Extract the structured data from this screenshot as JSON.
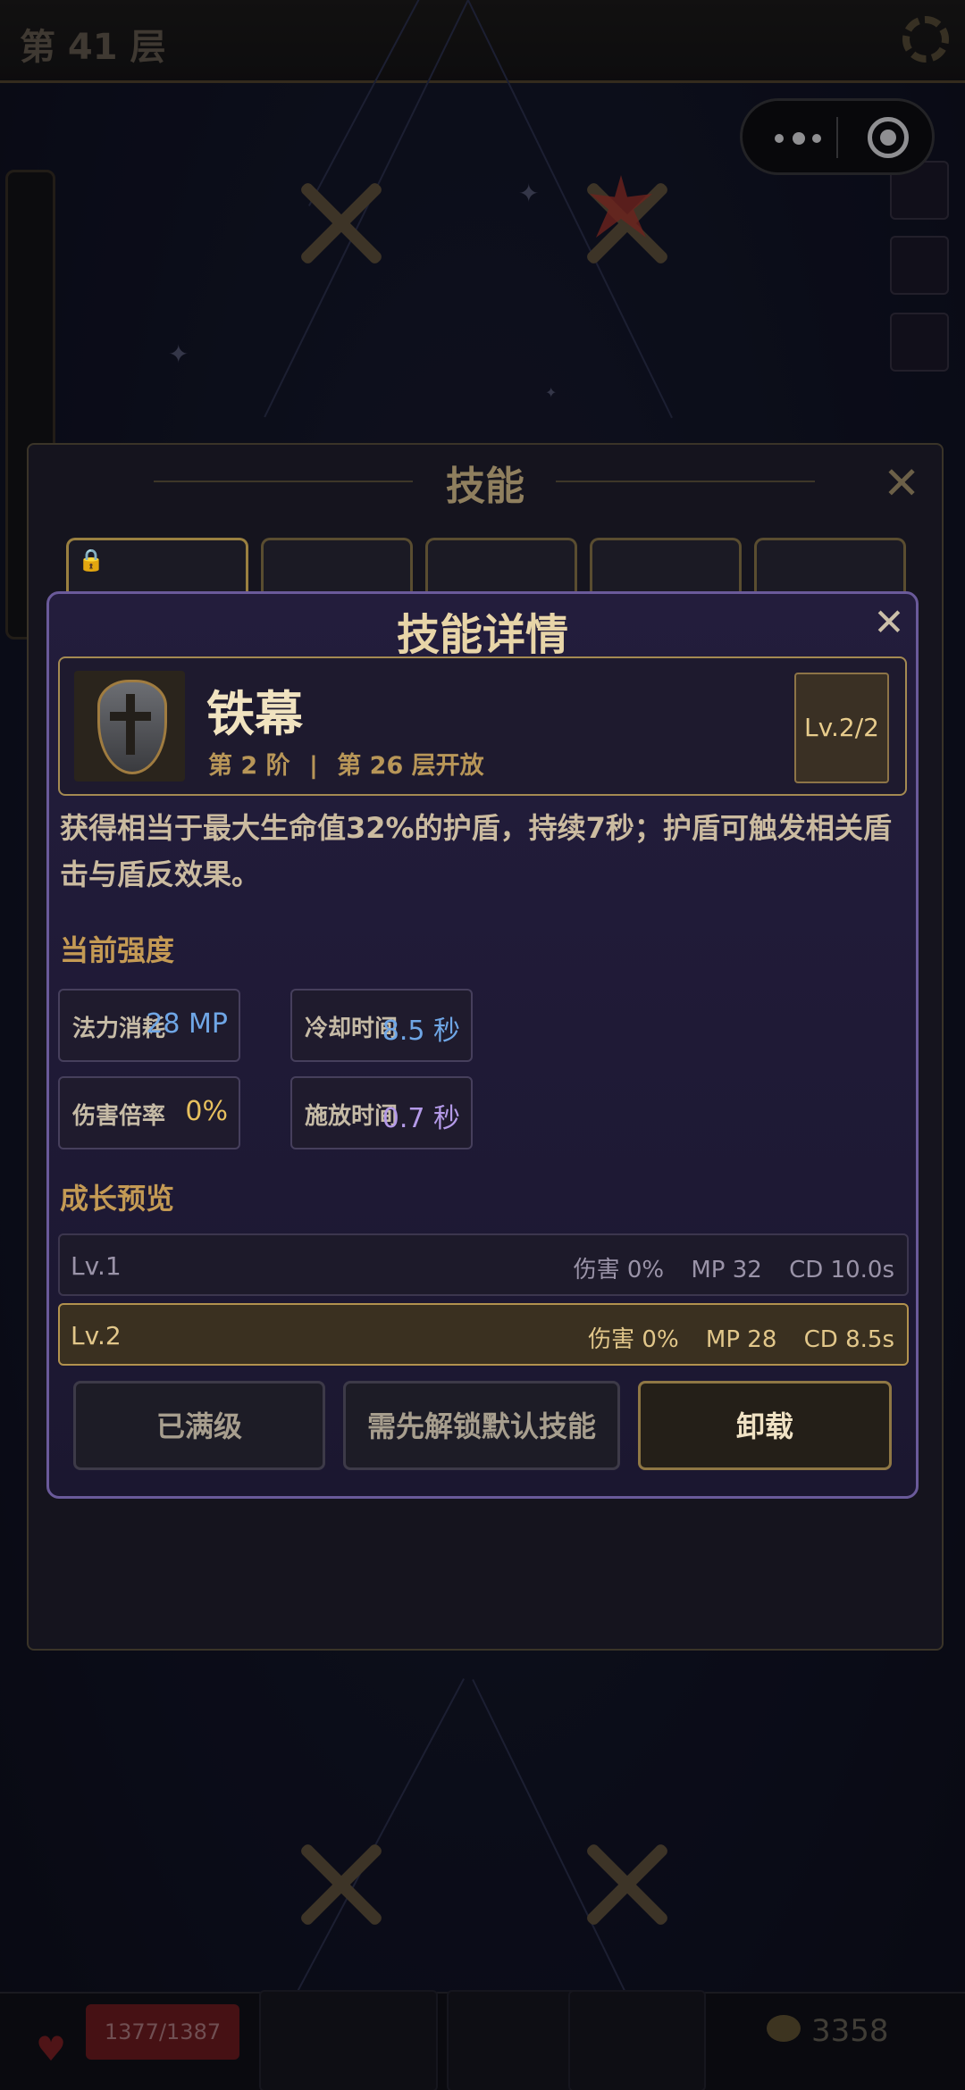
{
  "header": {
    "floor_title": "第 41 层"
  },
  "bottom_bar": {
    "hp": "1377/1387",
    "gold": "3358"
  },
  "skill_panel": {
    "title": "技能"
  },
  "modal": {
    "title": "技能详情",
    "close_label": "✕",
    "skill": {
      "name": "铁幕",
      "tier": "第 2 阶",
      "separator": "|",
      "unlock": "第 26 层开放",
      "level": "Lv.2/2",
      "icon": "tower-shield-icon"
    },
    "description": "获得相当于最大生命值32%的护盾，持续7秒；护盾可触发相关盾击与盾反效果。",
    "current_strength": {
      "heading": "当前强度",
      "stats": [
        {
          "label": "法力消耗",
          "value": "28 MP",
          "color": "#6fa6e6"
        },
        {
          "label": "冷却时间",
          "value": "8.5 秒",
          "color": "#6fa6e6"
        },
        {
          "label": "伤害倍率",
          "value": "0%",
          "color": "#e7c05e"
        },
        {
          "label": "施放时间",
          "value": "0.7 秒",
          "color": "#b49ae8"
        }
      ]
    },
    "growth_preview": {
      "heading": "成长预览",
      "rows": [
        {
          "level": "Lv.1",
          "damage": "伤害 0%",
          "mp": "MP 32",
          "cd": "CD 10.0s"
        },
        {
          "level": "Lv.2",
          "damage": "伤害 0%",
          "mp": "MP 28",
          "cd": "CD 8.5s"
        }
      ]
    },
    "buttons": {
      "maxed": "已满级",
      "unlock_default": "需先解锁默认技能",
      "unequip": "卸载"
    }
  }
}
